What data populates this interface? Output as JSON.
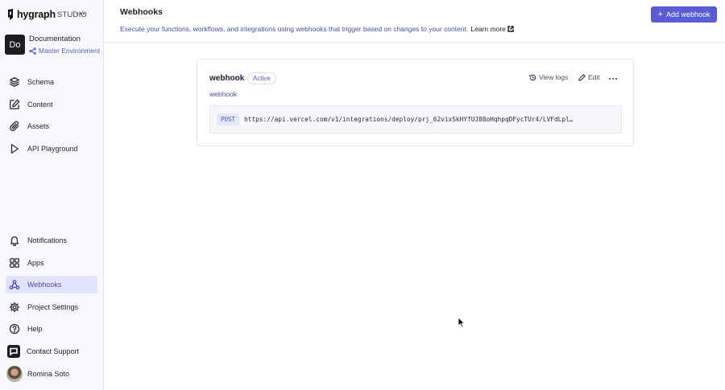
{
  "brand": {
    "name": "hygraph",
    "suffix": "STUDIO"
  },
  "project": {
    "initials": "Do",
    "name": "Documentation",
    "environment": "Master Environment"
  },
  "nav_top": [
    {
      "label": "Schema",
      "icon": "layers-icon"
    },
    {
      "label": "Content",
      "icon": "edit-icon"
    },
    {
      "label": "Assets",
      "icon": "paperclip-icon"
    },
    {
      "label": "API Playground",
      "icon": "play-icon"
    }
  ],
  "nav_bottom": [
    {
      "label": "Notifications",
      "icon": "bell-icon"
    },
    {
      "label": "Apps",
      "icon": "grid-icon"
    },
    {
      "label": "Webhooks",
      "icon": "webhook-icon",
      "active": true
    },
    {
      "label": "Project Settings",
      "icon": "gear-icon"
    },
    {
      "label": "Help",
      "icon": "help-icon"
    },
    {
      "label": "Contact Support",
      "icon": "chat-icon"
    },
    {
      "label": "Romina Soto",
      "icon": "user-avatar"
    }
  ],
  "header": {
    "title": "Webhooks",
    "description": "Execute your functions, workflows, and integrations using webhooks that trigger based on changes to your content.",
    "learn_more": "Learn more",
    "add_button": "Add webhook"
  },
  "webhook": {
    "name": "webhook",
    "status": "Active",
    "description": "webhook",
    "view_logs": "View logs",
    "edit": "Edit",
    "method": "POST",
    "url": "https://api.vercel.com/v1/integrations/deploy/prj_62vixSkHYfUJ88oHqhpqDFycTUr4/LVFdLpl…"
  },
  "colors": {
    "accent": "#5b5bd6",
    "active_bg": "#e2e3fb",
    "sidebar_bg": "#f7f8fb"
  }
}
